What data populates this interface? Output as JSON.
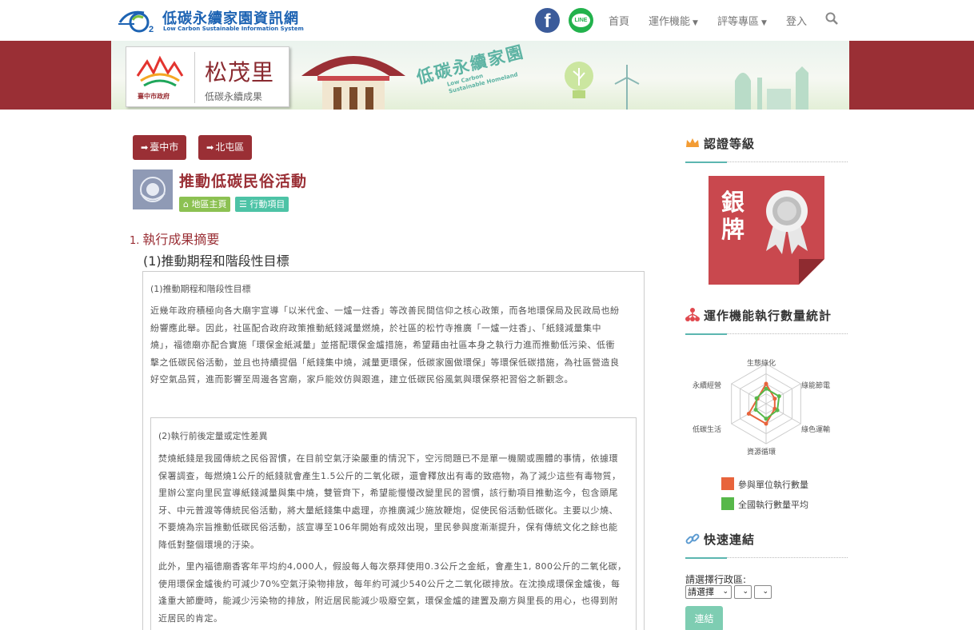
{
  "site": {
    "title": "低碳永續家園資訊網",
    "subtitle": "Low Carbon Sustainable Information System"
  },
  "nav": {
    "facebook": "f",
    "line": "LINE",
    "home": "首頁",
    "features": "運作機能",
    "evaluation": "評等專區",
    "login": "登入",
    "search_icon": "search-icon"
  },
  "banner": {
    "village": "松茂里",
    "village_sub": "低碳永續成果",
    "seal": "臺中市政府",
    "title": "低碳永續家園",
    "title_en": "Low Carbon\nSustainable Homeland"
  },
  "breadcrumb": [
    "臺中市",
    "北屯區"
  ],
  "action": {
    "title": "推動低碳民俗活動",
    "tag_home": "地區主頁",
    "tag_items": "行動項目"
  },
  "content": {
    "section_num": "1.",
    "section_title": "執行成果摘要",
    "subsection": "(1)推動期程和階段性目標",
    "box1_head": "(1)推動期程和階段性目標",
    "box1_lines": [
      "近幾年政府積極向各大廟宇宣導「以米代金、一爐一炷香」等改善民間信仰之核心政策，而各地環保局及民政局也紛",
      "紛響應此舉。因此，社區配合政府政策推動紙錢減量燃燒，於社區的松竹寺推廣「一爐一炷香」、「紙錢減量集中",
      "燒」，福德廟亦配合實施「環保金紙減量」並搭配環保金爐措施，希望藉由社區本身之執行力進而推動低污染、低衝",
      "擊之低碳民俗活動，並且也持續提倡「紙錢集中燒，減量更環保，低碳家園做環保」等環保低碳措施，為社區營造良",
      "好空氣品質，進而影響至周邊各宮廟，家戶能效仿與跟進，建立低碳民俗風氣與環保祭祀習俗之新觀念。"
    ],
    "box2_head": "(2)執行前後定量或定性差異",
    "box2_p1": [
      "焚燒紙錢是我國傳統之民俗習慣，在目前空氣汙染嚴重的情況下，空污問題已不是單一機關或團體的事情，依據環",
      "保署調查，每燃燒1公斤的紙錢就會產生1.5公斤的二氧化碳，還會釋放出有毒的致癌物，為了減少這些有毒物質，",
      "里辦公室向里民宣導紙錢減量與集中燒，雙管齊下，希望能慢慢改變里民的習慣，該行動項目推動迄今，包含頭尾",
      "牙、中元普渡等傳統民俗活動，將大量紙錢集中處理，亦推廣減少施放鞭炮，促使民俗活動低碳化。主要以少燒、",
      "不要燒為宗旨推動低碳民俗活動，該宣導至106年開始有成效出現，里民參與度漸漸提升，保有傳統文化之餘也能",
      "降低對整個環境的汙染。"
    ],
    "box2_p2": [
      "此外，里內福德廟香客年平均約4,000人，假設每人每次祭拜使用0.3公斤之金紙，會產生1, 800公斤的二氧化碳，",
      "使用環保金爐後約可減少70%空氣汙染物排放，每年約可減少540公斤之二氧化碳排放。在沈換成環保金爐後，每",
      "逢重大節慶時，能減少污染物的排放，附近居民能減少吸廢空氣，環保金爐的建置及廟方與里長的用心，也得到附",
      "近居民的肯定。"
    ]
  },
  "sidebar": {
    "cert_title": "認證等級",
    "medal_text": "銀牌",
    "stats_title": "運作機能執行數量統計",
    "radar_axes": [
      "生態綠化",
      "綠能節電",
      "綠色運輸",
      "資源循環",
      "低碳生活",
      "永續經營"
    ],
    "legend": [
      {
        "label": "參與單位執行數量",
        "color": "#e8643c"
      },
      {
        "label": "全國執行數量平均",
        "color": "#57b84a"
      }
    ],
    "quick_title": "快速連結",
    "district_label": "請選擇行政區:",
    "select1": "請選擇",
    "submit": "連結"
  },
  "chart_data": {
    "type": "radar",
    "categories": [
      "生態綠化",
      "綠能節電",
      "綠色運輸",
      "資源循環",
      "低碳生活",
      "永續經營"
    ],
    "series": [
      {
        "name": "參與單位執行數量",
        "values": [
          2,
          1,
          1,
          2,
          2,
          1
        ]
      },
      {
        "name": "全國執行數量平均",
        "values": [
          1.5,
          1.5,
          1.3,
          1.5,
          1.2,
          1.1
        ]
      }
    ],
    "rlim": [
      0,
      4
    ],
    "legend_position": "bottom"
  }
}
